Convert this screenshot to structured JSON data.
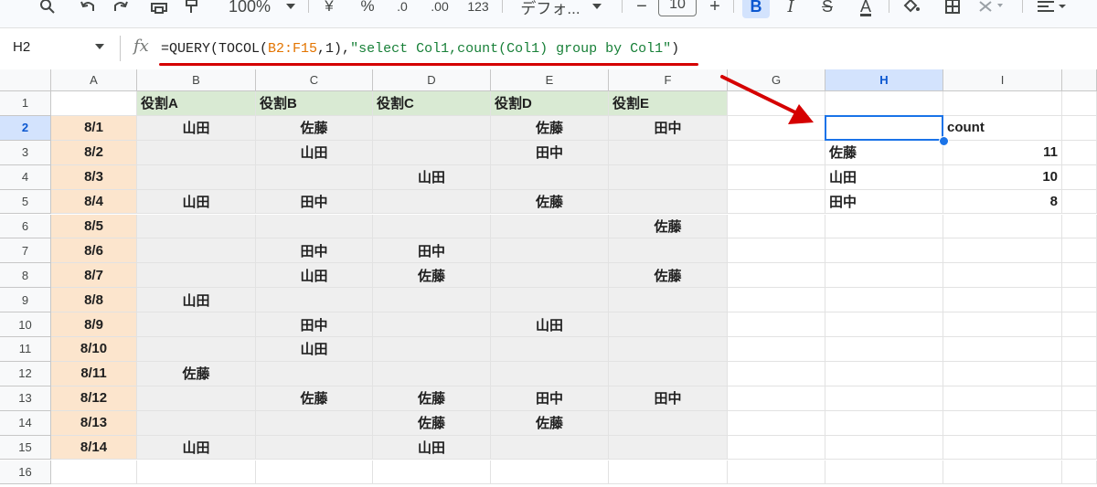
{
  "toolbar": {
    "zoom": "100%",
    "currency": "¥",
    "percent": "%",
    "dec_decrease": ".0",
    "dec_increase": ".00",
    "format_123": "123",
    "font": "デフォ...",
    "font_size": "10",
    "minus": "−",
    "plus": "+",
    "bold": "B",
    "italic": "I",
    "strike": "S",
    "text_color": "A"
  },
  "formula_bar": {
    "name_box": "H2",
    "fx": "fx",
    "formula_prefix": "=QUERY(TOCOL(",
    "formula_range": "B2:F15",
    "formula_mid": ",1),",
    "formula_string": "\"select Col1,count(Col1) group by Col1\"",
    "formula_suffix": ")"
  },
  "columns": [
    "A",
    "B",
    "C",
    "D",
    "E",
    "F",
    "G",
    "H",
    "I"
  ],
  "rows": [
    [
      "",
      "役割A",
      "役割B",
      "役割C",
      "役割D",
      "役割E",
      "",
      "",
      ""
    ],
    [
      "8/1",
      "山田",
      "佐藤",
      "",
      "佐藤",
      "田中",
      "",
      "",
      "count"
    ],
    [
      "8/2",
      "",
      "山田",
      "",
      "田中",
      "",
      "",
      "佐藤",
      "11"
    ],
    [
      "8/3",
      "",
      "",
      "山田",
      "",
      "",
      "",
      "山田",
      "10"
    ],
    [
      "8/4",
      "山田",
      "田中",
      "",
      "佐藤",
      "",
      "",
      "田中",
      "8"
    ],
    [
      "8/5",
      "",
      "",
      "",
      "",
      "佐藤",
      "",
      "",
      ""
    ],
    [
      "8/6",
      "",
      "田中",
      "田中",
      "",
      "",
      "",
      "",
      ""
    ],
    [
      "8/7",
      "",
      "山田",
      "佐藤",
      "",
      "佐藤",
      "",
      "",
      ""
    ],
    [
      "8/8",
      "山田",
      "",
      "",
      "",
      "",
      "",
      "",
      ""
    ],
    [
      "8/9",
      "",
      "田中",
      "",
      "山田",
      "",
      "",
      "",
      ""
    ],
    [
      "8/10",
      "",
      "山田",
      "",
      "",
      "",
      "",
      "",
      ""
    ],
    [
      "8/11",
      "佐藤",
      "",
      "",
      "",
      "",
      "",
      "",
      ""
    ],
    [
      "8/12",
      "",
      "佐藤",
      "佐藤",
      "田中",
      "田中",
      "",
      "",
      ""
    ],
    [
      "8/13",
      "",
      "",
      "佐藤",
      "佐藤",
      "",
      "",
      "",
      ""
    ],
    [
      "8/14",
      "山田",
      "",
      "山田",
      "",
      "",
      "",
      "",
      ""
    ],
    [
      "",
      "",
      "",
      "",
      "",
      "",
      "",
      "",
      ""
    ]
  ],
  "selected_cell": "H2",
  "colors": {
    "date_fill": "#fce5cd",
    "header_fill": "#d9ead3",
    "range_fill": "#efefef",
    "selection": "#1a73e8",
    "annotation": "#d50000"
  }
}
